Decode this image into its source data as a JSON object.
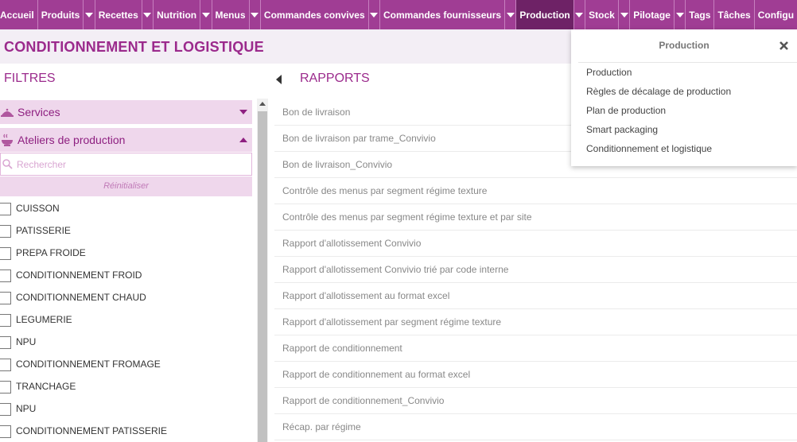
{
  "nav": {
    "items": [
      {
        "label": "Accueil",
        "caret": false
      },
      {
        "label": "Produits",
        "caret": true
      },
      {
        "label": "Recettes",
        "caret": true
      },
      {
        "label": "Nutrition",
        "caret": true
      },
      {
        "label": "Menus",
        "caret": true
      },
      {
        "label": "Commandes convives",
        "caret": true
      },
      {
        "label": "Commandes fournisseurs",
        "caret": true
      },
      {
        "label": "Production",
        "caret": true,
        "active": true
      },
      {
        "label": "Stock",
        "caret": true
      },
      {
        "label": "Pilotage",
        "caret": true
      },
      {
        "label": "Tags",
        "caret": false
      },
      {
        "label": "Tâches",
        "caret": false
      },
      {
        "label": "Configu",
        "caret": false
      }
    ]
  },
  "page": {
    "title": "CONDITIONNEMENT ET LOGISTIQUE"
  },
  "filters": {
    "title": "FILTRES",
    "services_label": "Services",
    "ateliers_label": "Ateliers de production",
    "search_placeholder": "Rechercher",
    "reset_label": "Réinitialiser",
    "items": [
      "CUISSON",
      "PATISSERIE",
      "PREPA FROIDE",
      "CONDITIONNEMENT FROID",
      "CONDITIONNEMENT CHAUD",
      "LEGUMERIE",
      "NPU",
      "CONDITIONNEMENT FROMAGE",
      "TRANCHAGE",
      "NPU",
      "CONDITIONNEMENT PATISSERIE"
    ]
  },
  "rapports": {
    "title": "RAPPORTS",
    "items": [
      "Bon de livraison",
      "Bon de livraison par trame_Convivio",
      "Bon de livraison_Convivio",
      "Contrôle des menus par segment régime texture",
      "Contrôle des menus par segment régime texture et par site",
      "Rapport d'allotissement Convivio",
      "Rapport d'allotissement Convivio trié par code interne",
      "Rapport d'allotissement au format excel",
      "Rapport d'allotissement par segment régime texture",
      "Rapport de conditionnement",
      "Rapport de conditionnement au format excel",
      "Rapport de conditionnement_Convivio",
      "Récap. par régime"
    ]
  },
  "dropdown": {
    "title": "Production",
    "items": [
      "Production",
      "Règles de décalage de production",
      "Plan de production",
      "Smart packaging",
      "Conditionnement et logistique"
    ]
  },
  "colors": {
    "nav_bg": "#a03d94",
    "nav_active": "#6e2266",
    "accent": "#9b2a8c",
    "accordion_bg": "#efd7ec"
  },
  "icons": {
    "services": "service-cloche-icon",
    "ateliers": "cooking-pot-icon",
    "search": "search-icon",
    "close": "close-icon"
  }
}
